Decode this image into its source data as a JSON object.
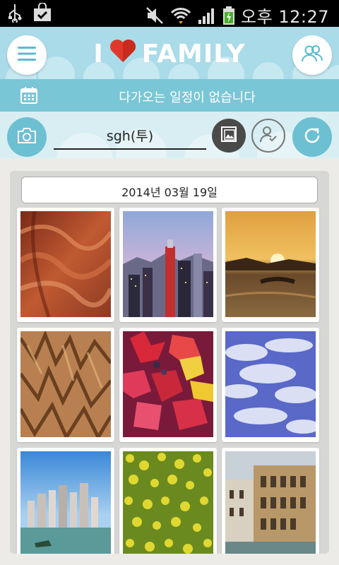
{
  "status_bar": {
    "time": "오후 12:27",
    "icons": [
      "usb-icon",
      "shopping-bag-icon",
      "mute-icon",
      "wifi-icon",
      "signal-icon",
      "battery-charging-icon"
    ]
  },
  "header": {
    "logo_i": "I",
    "logo_word": "FAMILY",
    "schedule_text": "다가오는 일정이 없습니다",
    "user_name": "sgh(투)"
  },
  "content": {
    "date_label": "2014년 03월 19일",
    "photos": [
      {
        "name": "red-canyon-rock"
      },
      {
        "name": "city-skyline-dusk"
      },
      {
        "name": "sunset-over-water"
      },
      {
        "name": "eroded-sand-hills"
      },
      {
        "name": "autumn-maple-leaves"
      },
      {
        "name": "blue-sky-clouds"
      },
      {
        "name": "harbor-city-towers"
      },
      {
        "name": "yellow-flower-field"
      },
      {
        "name": "venice-canal-buildings"
      }
    ]
  },
  "colors": {
    "header_sky": "#a9dbe8",
    "schedule_bar": "#79c6d6",
    "accent_button": "#6cc0d2",
    "logo_heart": "#e0392b"
  }
}
